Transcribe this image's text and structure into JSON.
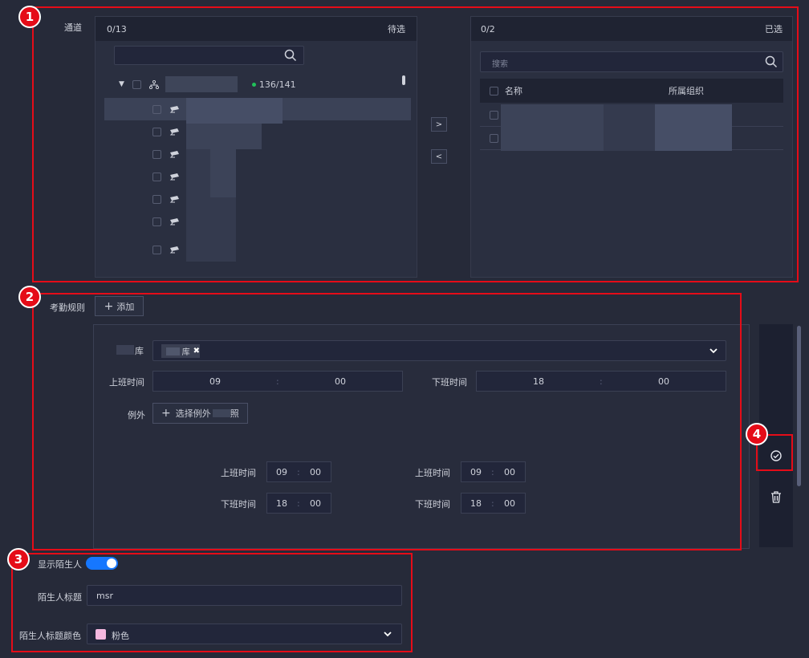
{
  "channel": {
    "label": "通道",
    "pending": {
      "count": "0/13",
      "title": "待选",
      "root_count": "136/141"
    },
    "selected": {
      "count": "0/2",
      "title": "已选",
      "search_placeholder": "搜索",
      "col_name": "名称",
      "col_org": "所属组织"
    },
    "move_right": ">",
    "move_left": "<"
  },
  "attendance": {
    "label": "考勤规则",
    "add_button": "添加",
    "library_label": "库",
    "library_tag": "库",
    "on_time_label": "上班时间",
    "off_time_label": "下班时间",
    "on_time": {
      "h": "09",
      "m": "00"
    },
    "off_time": {
      "h": "18",
      "m": "00"
    },
    "exception_label": "例外",
    "exception_button_prefix": "选择例外",
    "exception_button_suffix": "照",
    "ex_left": {
      "on_label": "上班时间",
      "on_h": "09",
      "on_m": "00",
      "off_label": "下班时间",
      "off_h": "18",
      "off_m": "00"
    },
    "ex_right": {
      "on_label": "上班时间",
      "on_h": "09",
      "on_m": "00",
      "off_label": "下班时间",
      "off_h": "18",
      "off_m": "00"
    }
  },
  "stranger": {
    "show_label": "显示陌生人",
    "show_enabled": true,
    "title_label": "陌生人标题",
    "title_value": "msr",
    "color_label": "陌生人标题颜色",
    "color_value": "粉色",
    "color_swatch": "#f5b8e0"
  },
  "markers": {
    "m1": "1",
    "m2": "2",
    "m3": "3",
    "m4": "4"
  },
  "colors": {
    "accent": "#1677ff",
    "highlight": "#e50c18",
    "status_dot": "#21c15a"
  }
}
